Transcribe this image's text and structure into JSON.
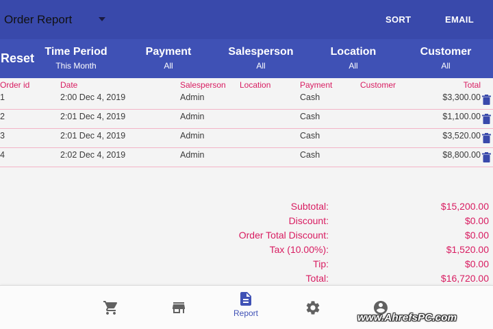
{
  "appbar": {
    "report_selector": "Order Report",
    "sort_label": "SORT",
    "email_label": "EMAIL",
    "colors": {
      "appbar_bg": "#3949ab",
      "filterbar_bg": "#3f51b5",
      "accent_pink": "#d81b60"
    }
  },
  "filters": {
    "reset_label": "Reset",
    "items": [
      {
        "name": "Time Period",
        "value": "This Month"
      },
      {
        "name": "Payment",
        "value": "All"
      },
      {
        "name": "Salesperson",
        "value": "All"
      },
      {
        "name": "Location",
        "value": "All"
      },
      {
        "name": "Customer",
        "value": "All"
      }
    ]
  },
  "table": {
    "headers": {
      "order_id": "Order id",
      "date": "Date",
      "salesperson": "Salesperson",
      "location": "Location",
      "payment": "Payment",
      "customer": "Customer",
      "total": "Total"
    },
    "rows": [
      {
        "id": "1",
        "date": "2:00 Dec 4, 2019",
        "salesperson": "Admin",
        "location": "",
        "payment": "Cash",
        "customer": "",
        "total": "$3,300.00"
      },
      {
        "id": "2",
        "date": "2:01 Dec 4, 2019",
        "salesperson": "Admin",
        "location": "",
        "payment": "Cash",
        "customer": "",
        "total": "$1,100.00"
      },
      {
        "id": "3",
        "date": "2:01 Dec 4, 2019",
        "salesperson": "Admin",
        "location": "",
        "payment": "Cash",
        "customer": "",
        "total": "$3,520.00"
      },
      {
        "id": "4",
        "date": "2:02 Dec 4, 2019",
        "salesperson": "Admin",
        "location": "",
        "payment": "Cash",
        "customer": "",
        "total": "$8,800.00"
      }
    ],
    "row_action_icon": "trash-icon"
  },
  "summary": [
    {
      "label": "Subtotal:",
      "value": "$15,200.00"
    },
    {
      "label": "Discount:",
      "value": "$0.00"
    },
    {
      "label": "Order Total Discount:",
      "value": "$0.00"
    },
    {
      "label": "Tax (10.00%):",
      "value": "$1,520.00"
    },
    {
      "label": "Tip:",
      "value": "$0.00"
    },
    {
      "label": "Total:",
      "value": "$16,720.00"
    }
  ],
  "bottom_nav": {
    "items": [
      {
        "icon": "cart-icon",
        "label": ""
      },
      {
        "icon": "store-icon",
        "label": ""
      },
      {
        "icon": "report-icon",
        "label": "Report",
        "active": true
      },
      {
        "icon": "settings-icon",
        "label": ""
      },
      {
        "icon": "account-icon",
        "label": ""
      }
    ]
  },
  "watermark": "www.AhrefsPC.com"
}
